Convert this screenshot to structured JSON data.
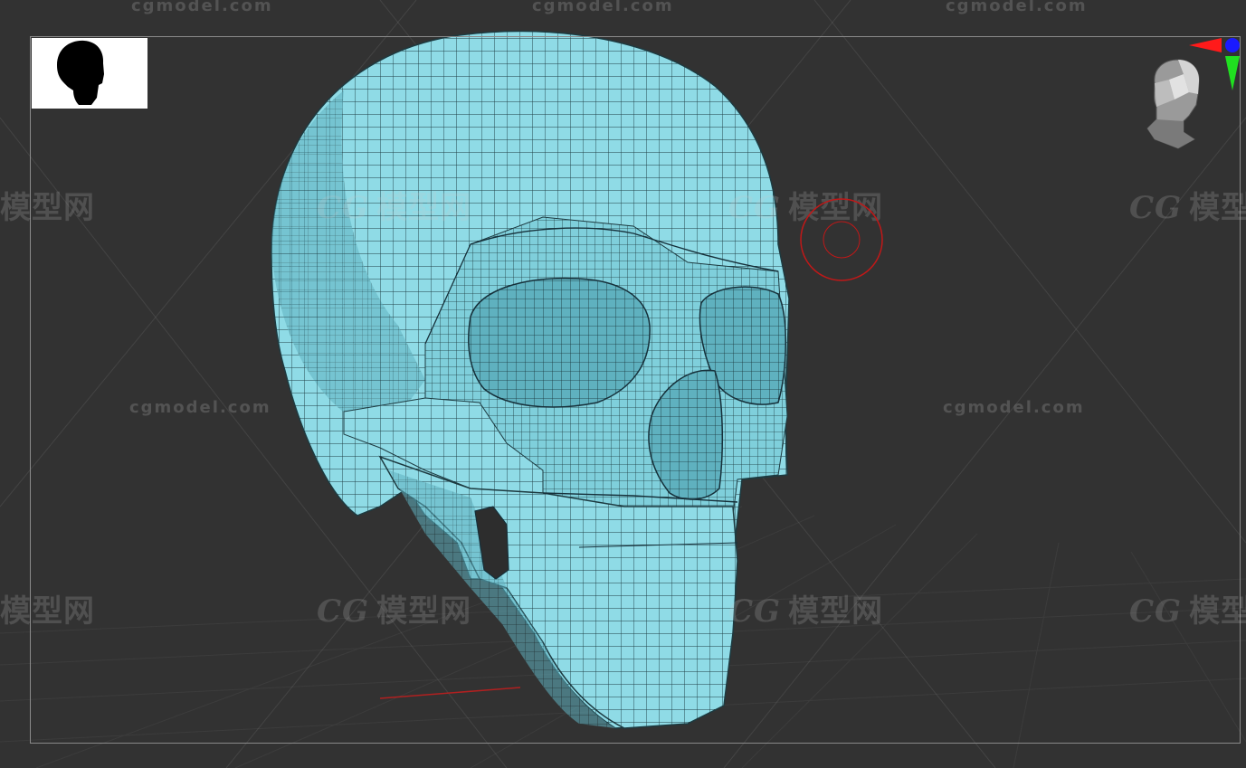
{
  "viewport": {
    "background": "#323232",
    "frame_color": "#8a8a8a"
  },
  "model": {
    "name": "skull",
    "color": "#86d6e2",
    "wire_color": "#1d3a40"
  },
  "watermarks": {
    "brand_cn": "模型网",
    "brand_en": "cgmodel.com",
    "logo_text": "CG"
  },
  "icons": {
    "thumbnail": "skull-silhouette-icon",
    "navigation": "head-navigation-icon",
    "axis": "axis-gizmo-icon",
    "cursor": "brush-cursor-icon"
  },
  "axis_colors": {
    "x": "#ff1a1a",
    "y": "#20e020",
    "z": "#1a1aff"
  },
  "cursor_color": "#c01818"
}
